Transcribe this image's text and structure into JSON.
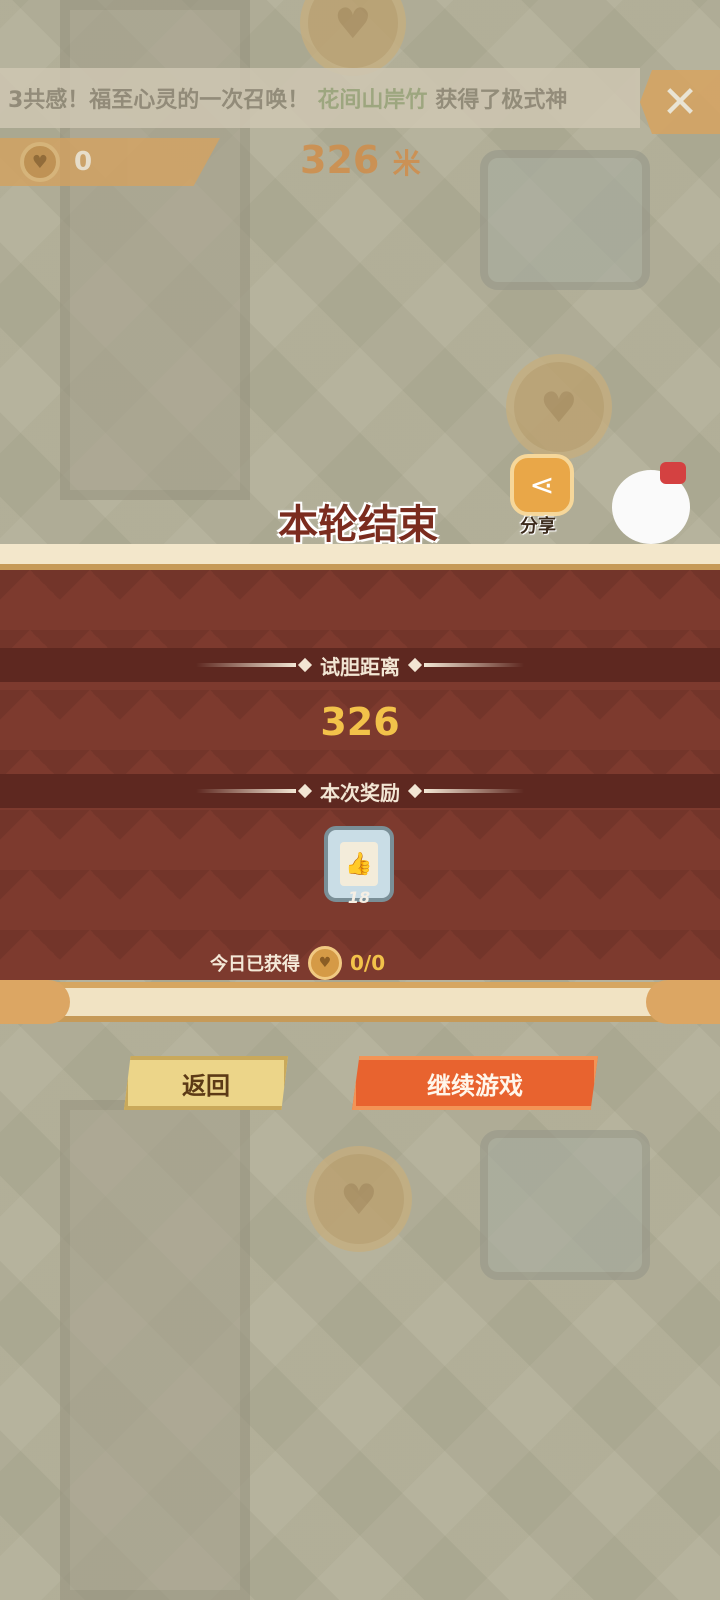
{
  "header": {
    "marquee_text": "3共感！福至心灵的一次召唤！",
    "marquee_highlight": "花间山岸竹",
    "marquee_tail": "获得了极式神",
    "close_icon": "close-icon",
    "coin_count": "0",
    "distance": "326",
    "distance_unit": "米"
  },
  "result": {
    "title": "本轮结束",
    "share_label": "分享",
    "distance_label": "试胆距离",
    "distance_value": "326",
    "reward_label": "本次奖励",
    "reward_item_count": "18",
    "today_label": "今日已获得",
    "today_value": "0/0"
  },
  "buttons": {
    "back": "返回",
    "continue": "继续游戏"
  },
  "colors": {
    "panel": "#7d3a2e",
    "band": "#5e2820",
    "gold_text": "#f2c24a",
    "continue_button": "#e8632f",
    "back_button": "#ecd589"
  }
}
